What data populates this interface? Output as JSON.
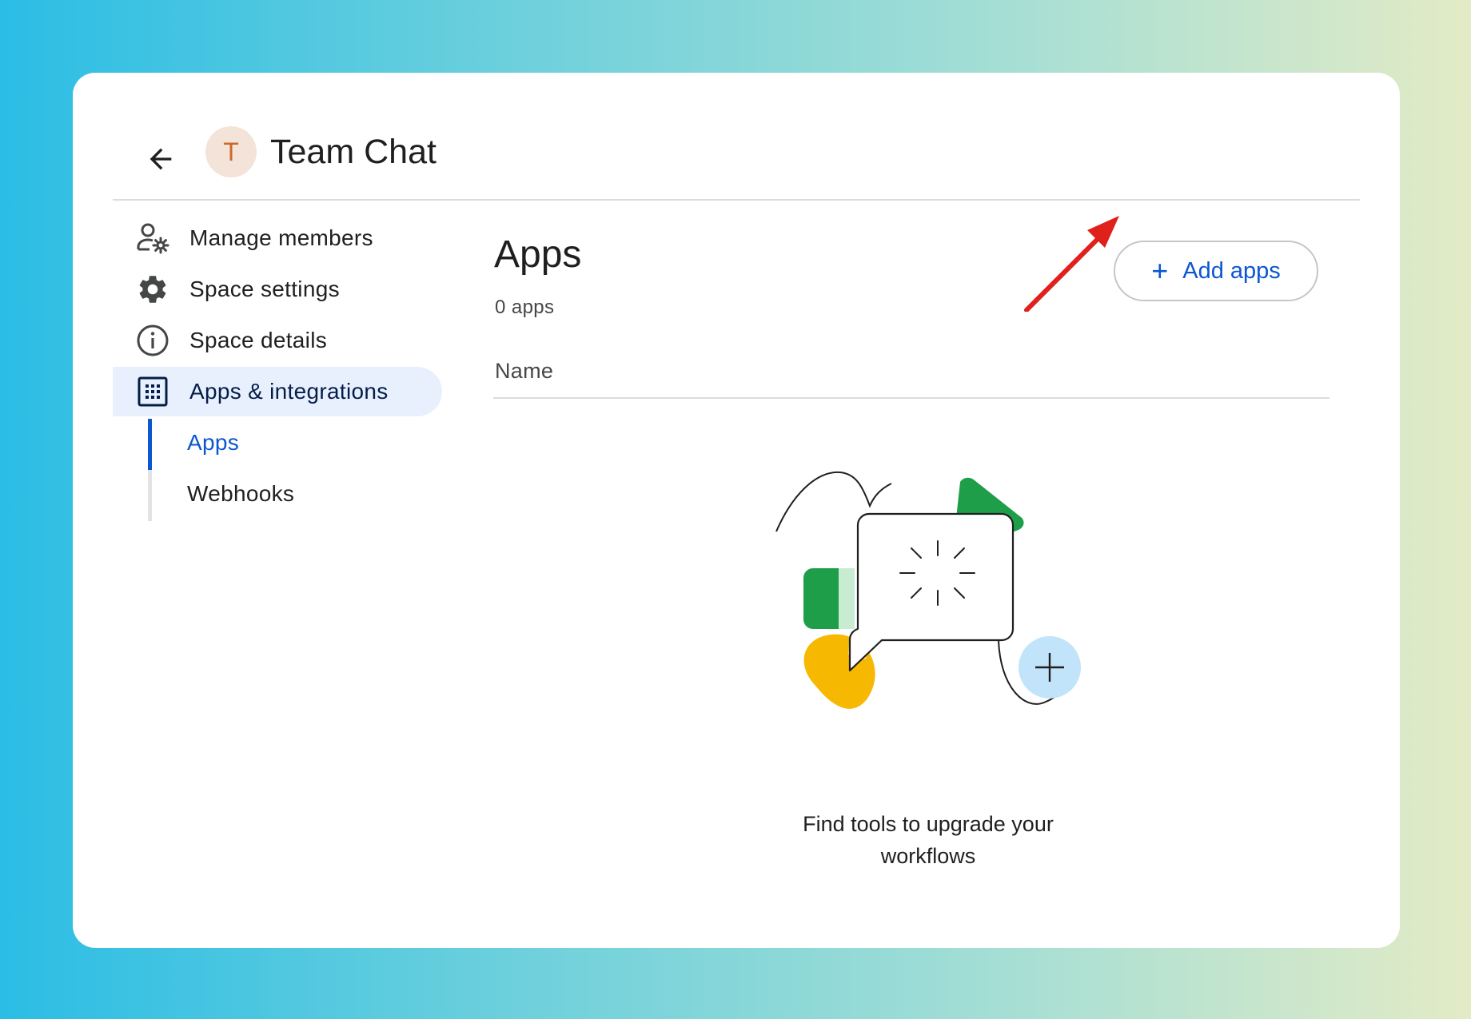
{
  "header": {
    "avatar_letter": "T",
    "title": "Team Chat"
  },
  "sidebar": {
    "items": [
      {
        "label": "Manage members",
        "icon": "manage-members-icon"
      },
      {
        "label": "Space settings",
        "icon": "gear-icon"
      },
      {
        "label": "Space details",
        "icon": "info-icon"
      },
      {
        "label": "Apps & integrations",
        "icon": "apps-grid-icon",
        "active": true
      }
    ],
    "subitems": [
      {
        "label": "Apps",
        "active": true
      },
      {
        "label": "Webhooks"
      }
    ]
  },
  "main": {
    "title": "Apps",
    "count": "0 apps",
    "add_button": "Add apps",
    "column_header": "Name",
    "empty_state_line1": "Find tools to upgrade your",
    "empty_state_line2": "workflows"
  },
  "colors": {
    "accent": "#0b57d0",
    "active_nav_bg": "#e8f0fe",
    "annotation_arrow": "#e0201b"
  }
}
